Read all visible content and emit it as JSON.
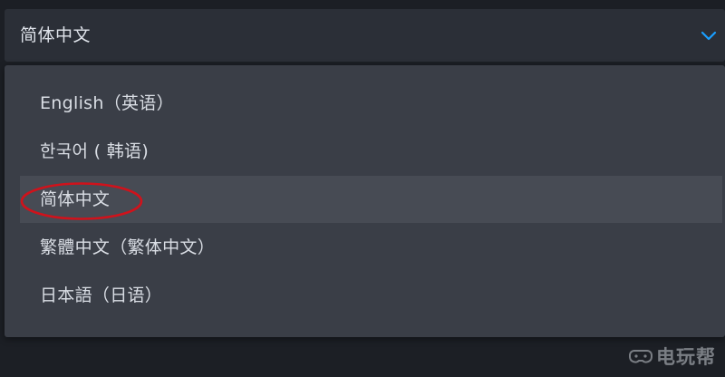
{
  "dropdown": {
    "selected_value": "简体中文",
    "chevron_icon": "chevron-down-icon",
    "chevron_color": "#1a9fff"
  },
  "menu": {
    "items": [
      {
        "label": "English（英语）"
      },
      {
        "label": "한국어 ( 韩语)"
      },
      {
        "label": "简体中文",
        "active": true
      },
      {
        "label": "繁體中文（繁体中文）"
      },
      {
        "label": "日本語（日语）"
      }
    ]
  },
  "annotation": {
    "oval_color": "#d0121b"
  },
  "watermark": {
    "text": "电玩帮",
    "icon": "game-controller-icon"
  }
}
